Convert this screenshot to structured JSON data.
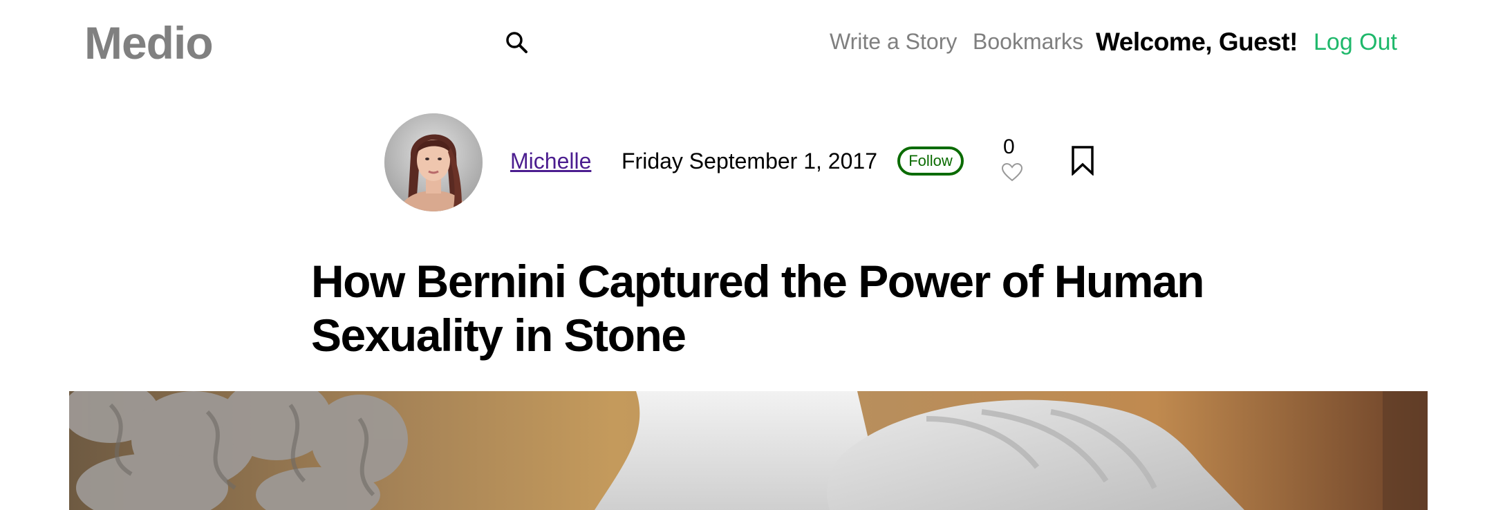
{
  "header": {
    "logo": "Medio",
    "nav": {
      "write_story": "Write a Story",
      "bookmarks": "Bookmarks"
    },
    "welcome": "Welcome, Guest!",
    "logout": "Log Out"
  },
  "byline": {
    "author": "Michelle",
    "date": "Friday September 1, 2017",
    "follow_label": "Follow",
    "likes": "0"
  },
  "article": {
    "title": "How Bernini Captured the Power of Human Sexuality in Stone"
  },
  "colors": {
    "brand_green": "#1fb86b",
    "follow_green": "#0a6b00",
    "author_link": "#4b1d8f",
    "logo_gray": "#808080",
    "nav_gray": "#7f7f7f"
  },
  "icons": {
    "search": "search-icon",
    "like": "heart-icon",
    "bookmark": "bookmark-icon"
  }
}
